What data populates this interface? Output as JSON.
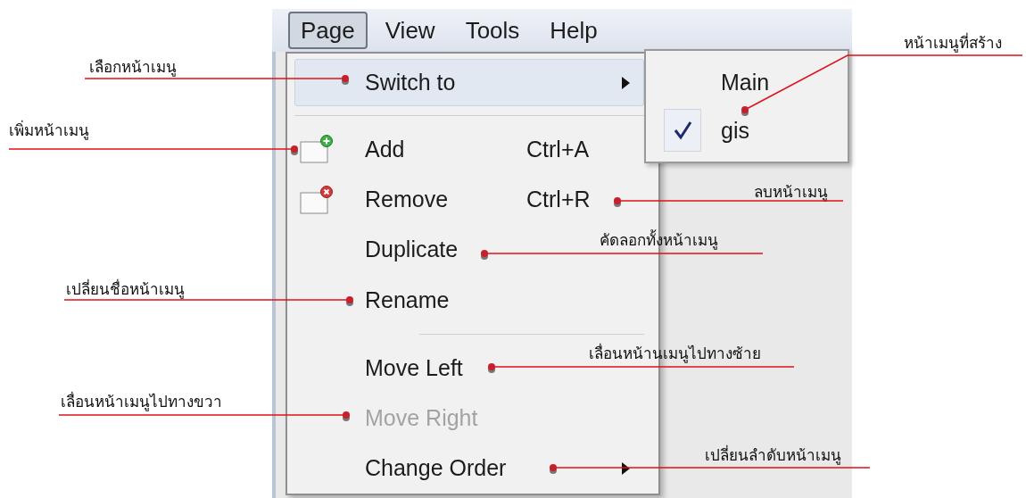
{
  "menubar": [
    {
      "label": "Page",
      "selected": true
    },
    {
      "label": "View",
      "selected": false
    },
    {
      "label": "Tools",
      "selected": false
    },
    {
      "label": "Help",
      "selected": false
    }
  ],
  "menu": {
    "items": [
      {
        "kind": "item",
        "label": "Switch to",
        "highlighted": true,
        "disabled": false,
        "submenu": true
      },
      {
        "kind": "separator"
      },
      {
        "kind": "add",
        "label": "Add",
        "shortcut": "Ctrl+A",
        "highlighted": false,
        "disabled": false,
        "submenu": false
      },
      {
        "kind": "remove",
        "label": "Remove",
        "shortcut": "Ctrl+R",
        "highlighted": false,
        "disabled": false,
        "submenu": false
      },
      {
        "kind": "item",
        "label": "Duplicate",
        "highlighted": false,
        "disabled": false,
        "submenu": false
      },
      {
        "kind": "item",
        "label": "Rename",
        "highlighted": false,
        "disabled": false,
        "submenu": false
      },
      {
        "kind": "separator"
      },
      {
        "kind": "item",
        "label": "Move Left",
        "highlighted": false,
        "disabled": false,
        "submenu": false
      },
      {
        "kind": "item",
        "label": "Move Right",
        "highlighted": false,
        "disabled": true,
        "submenu": false
      },
      {
        "kind": "item",
        "label": "Change Order",
        "highlighted": false,
        "disabled": false,
        "submenu": true
      }
    ]
  },
  "submenu": {
    "items": [
      {
        "label": "Main",
        "checked": false
      },
      {
        "label": "gis",
        "checked": true
      }
    ]
  },
  "annotations": [
    {
      "text": "เลือกหน้าเมนู"
    },
    {
      "text": "เพิ่มหน้าเมนู"
    },
    {
      "text": "หน้าเมนูที่สร้าง"
    },
    {
      "text": "ลบหน้าเมนู"
    },
    {
      "text": "คัดลอกทั้งหน้าเมนู"
    },
    {
      "text": "เปลี่ยนชื่อหน้าเมนู"
    },
    {
      "text": "เลื่อนหน้านเมนูไปทางซ้าย"
    },
    {
      "text": "เลื่อนหน้าเมนูไปทางขวา"
    },
    {
      "text": "เปลี่ยนลำดับหน้าเมนู"
    }
  ]
}
